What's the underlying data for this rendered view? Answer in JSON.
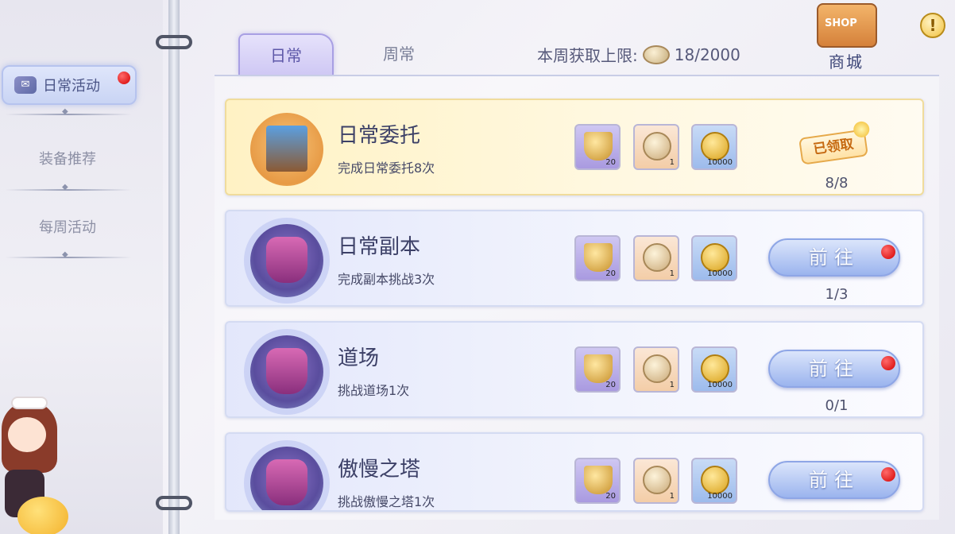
{
  "sidebar": {
    "items": [
      {
        "label": "日常活动",
        "active": true
      },
      {
        "label": "装备推荐",
        "active": false
      },
      {
        "label": "每周活动",
        "active": false
      }
    ]
  },
  "tabs": [
    {
      "label": "日常",
      "active": true
    },
    {
      "label": "周常",
      "active": false
    }
  ],
  "weekly_limit": {
    "label": "本周获取上限:",
    "value": "18/2000"
  },
  "shop": {
    "sign": "SHOP",
    "label": "商城"
  },
  "info_icon": "!",
  "tasks": [
    {
      "title": "日常委托",
      "desc": "完成日常委托8次",
      "rewards": [
        "20",
        "1",
        "10000"
      ],
      "status": "claimed",
      "status_label": "已领取",
      "progress": "8/8"
    },
    {
      "title": "日常副本",
      "desc": "完成副本挑战3次",
      "rewards": [
        "20",
        "1",
        "10000"
      ],
      "status": "go",
      "status_label": "前往",
      "progress": "1/3"
    },
    {
      "title": "道场",
      "desc": "挑战道场1次",
      "rewards": [
        "20",
        "1",
        "10000"
      ],
      "status": "go",
      "status_label": "前往",
      "progress": "0/1"
    },
    {
      "title": "傲慢之塔",
      "desc": "挑战傲慢之塔1次",
      "rewards": [
        "20",
        "1",
        "10000"
      ],
      "status": "go",
      "status_label": "前往",
      "progress": ""
    }
  ]
}
